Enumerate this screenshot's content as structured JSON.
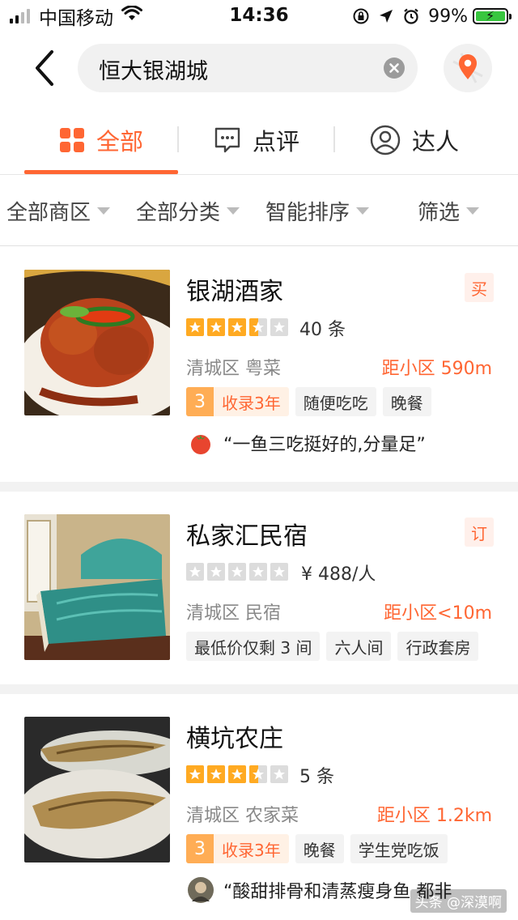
{
  "status_bar": {
    "carrier": "中国移动",
    "time": "14:36",
    "battery": "99%"
  },
  "search": {
    "query": "恒大银湖城"
  },
  "tabs": [
    {
      "label": "全部",
      "active": true
    },
    {
      "label": "点评",
      "active": false
    },
    {
      "label": "达人",
      "active": false
    }
  ],
  "filters": [
    "全部商区",
    "全部分类",
    "智能排序",
    "筛选"
  ],
  "listings": [
    {
      "name": "银湖酒家",
      "badge": "买",
      "rating": 3.5,
      "meta": "40 条",
      "area_category": "清城区  粤菜",
      "distance": "距小区 590m",
      "record_num": "3",
      "record_label": "收录3年",
      "tags": [
        "随便吃吃",
        "晚餐"
      ],
      "quote": "“一鱼三吃挺好的,分量足”"
    },
    {
      "name": "私家汇民宿",
      "badge": "订",
      "rating": 0,
      "meta": "¥ 488/人",
      "area_category": "清城区  民宿",
      "distance": "距小区<10m",
      "tags": [
        "最低价仅剩 3 间",
        "六人间",
        "行政套房"
      ]
    },
    {
      "name": "横坑农庄",
      "rating": 3.5,
      "meta": "5 条",
      "area_category": "清城区  农家菜",
      "distance": "距小区 1.2km",
      "record_num": "3",
      "record_label": "收录3年",
      "tags": [
        "晚餐",
        "学生党吃饭"
      ],
      "quote": "“酸甜排骨和清蒸瘦身鱼 都非"
    }
  ],
  "watermark": "头条 @深漠啊",
  "colors": {
    "accent": "#ff6633",
    "star": "#ffaa22"
  }
}
